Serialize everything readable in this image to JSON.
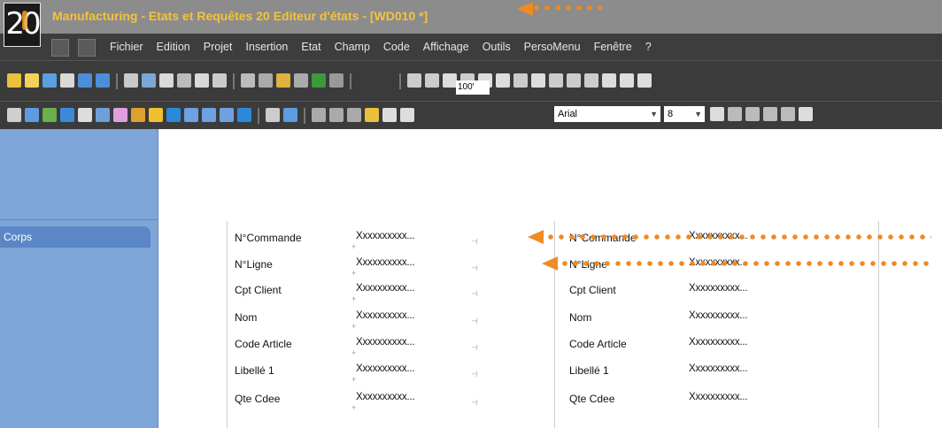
{
  "window": {
    "logo_text": "20",
    "title": "Manufacturing - Etats et Requêtes 20  Editeur d'états - [WD010 *]"
  },
  "menubar": {
    "items": [
      "Fichier",
      "Edition",
      "Projet",
      "Insertion",
      "Etat",
      "Champ",
      "Code",
      "Affichage",
      "Outils",
      "PersoMenu",
      "Fenêtre",
      "?"
    ]
  },
  "toolbar": {
    "zoom_value": "100'",
    "font_name": "Arial",
    "font_size": "8"
  },
  "report": {
    "section_label": "Corps",
    "left_block": {
      "labels": [
        "N°Commande",
        "N°Ligne",
        "Cpt Client",
        "Nom",
        "Code Article",
        "Libellé 1",
        "Qte Cdee"
      ],
      "values": [
        "Xxxxxxxxxx...",
        "Xxxxxxxxxx...",
        "Xxxxxxxxxx...",
        "Xxxxxxxxxx...",
        "Xxxxxxxxxx...",
        "Xxxxxxxxxx...",
        "Xxxxxxxxxx..."
      ]
    },
    "right_block": {
      "labels": [
        "N°Commande",
        "N°Ligne",
        "Cpt Client",
        "Nom",
        "Code Article",
        "Libellé 1",
        "Qte Cdee"
      ],
      "values": [
        "Xxxxxxxxxx...",
        "Xxxxxxxxxx...",
        "Xxxxxxxxxx...",
        "Xxxxxxxxxx...",
        "Xxxxxxxxxx...",
        "Xxxxxxxxxx...",
        "Xxxxxxxxxx..."
      ]
    }
  },
  "colors": {
    "annotation_arrow": "#f08a24",
    "title_text": "#f5c23a",
    "left_panel": "#7ea6d8"
  }
}
